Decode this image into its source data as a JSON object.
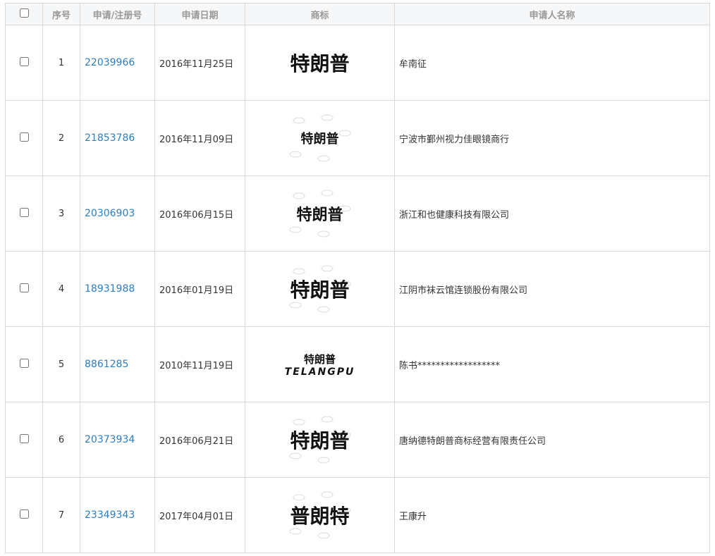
{
  "header": {
    "col_seq": "序号",
    "col_reg": "申请/注册号",
    "col_date": "申请日期",
    "col_mark": "商标",
    "col_applicant": "申请人名称"
  },
  "rows": [
    {
      "seq": "1",
      "reg": "22039966",
      "date": "2016年11月25日",
      "mark": "特朗普",
      "mark_sub": "",
      "applicant": "牟南征"
    },
    {
      "seq": "2",
      "reg": "21853786",
      "date": "2016年11月09日",
      "mark": "特朗普",
      "mark_sub": "",
      "applicant": "宁波市鄞州视力佳眼镜商行"
    },
    {
      "seq": "3",
      "reg": "20306903",
      "date": "2016年06月15日",
      "mark": "特朗普",
      "mark_sub": "",
      "applicant": "浙江和也健康科技有限公司"
    },
    {
      "seq": "4",
      "reg": "18931988",
      "date": "2016年01月19日",
      "mark": "特朗普",
      "mark_sub": "",
      "applicant": "江阴市袜云馆连锁股份有限公司"
    },
    {
      "seq": "5",
      "reg": "8861285",
      "date": "2010年11月19日",
      "mark": "特朗普",
      "mark_sub": "TELANGPU",
      "applicant": "陈书******************"
    },
    {
      "seq": "6",
      "reg": "20373934",
      "date": "2016年06月21日",
      "mark": "特朗普",
      "mark_sub": "",
      "applicant": "唐纳德特朗普商标经营有限责任公司"
    },
    {
      "seq": "7",
      "reg": "23349343",
      "date": "2017年04月01日",
      "mark": "普朗特",
      "mark_sub": "",
      "applicant": "王康升"
    }
  ]
}
